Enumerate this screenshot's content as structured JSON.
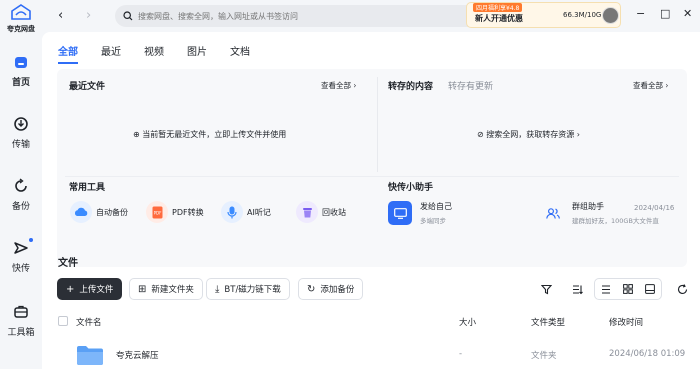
{
  "app": {
    "name": "夸克网盘"
  },
  "sidebar": {
    "items": [
      {
        "label": "首页",
        "icon": "home-icon"
      },
      {
        "label": "传输",
        "icon": "transfer-icon"
      },
      {
        "label": "备份",
        "icon": "backup-icon"
      },
      {
        "label": "快传",
        "icon": "quick-share-icon"
      },
      {
        "label": "工具箱",
        "icon": "toolbox-icon"
      }
    ]
  },
  "topbar": {
    "search_placeholder": "搜索网盘、搜索全网，输入网址或从书签访问",
    "promo_badge": "四月福利享¥4.8",
    "promo_text": "新人开通优惠",
    "quota": "66.3M/10G"
  },
  "tabs": [
    "全部",
    "最近",
    "视频",
    "图片",
    "文档"
  ],
  "recent": {
    "title": "最近文件",
    "more": "查看全部",
    "empty": "当前暂无最近文件，立即上传文件并使用"
  },
  "saved": {
    "title": "转存的内容",
    "subtitle": "转存有更新",
    "more": "查看全部",
    "empty": "搜索全网，获取转存资源"
  },
  "tools": {
    "title": "常用工具",
    "items": [
      {
        "label": "自动备份",
        "icon": "cloud-backup-icon"
      },
      {
        "label": "PDF转换",
        "icon": "pdf-icon"
      },
      {
        "label": "AI听记",
        "icon": "microphone-icon"
      },
      {
        "label": "回收站",
        "icon": "recycle-bin-icon"
      }
    ]
  },
  "helper": {
    "title": "快传小助手",
    "items": [
      {
        "title": "发给自己",
        "sub": "多端同步"
      },
      {
        "title": "群组助手",
        "sub": "建群加好友，100GB大文件直",
        "date": "2024/04/16"
      }
    ]
  },
  "files": {
    "title": "文件",
    "actions": [
      "上传文件",
      "新建文件夹",
      "BT/磁力链下载",
      "添加备份"
    ],
    "columns": [
      "文件名",
      "大小",
      "文件类型",
      "修改时间"
    ],
    "rows": [
      {
        "name": "夸克云解压",
        "size": "-",
        "type": "文件夹",
        "modified": "2024/06/18 01:09"
      }
    ]
  }
}
